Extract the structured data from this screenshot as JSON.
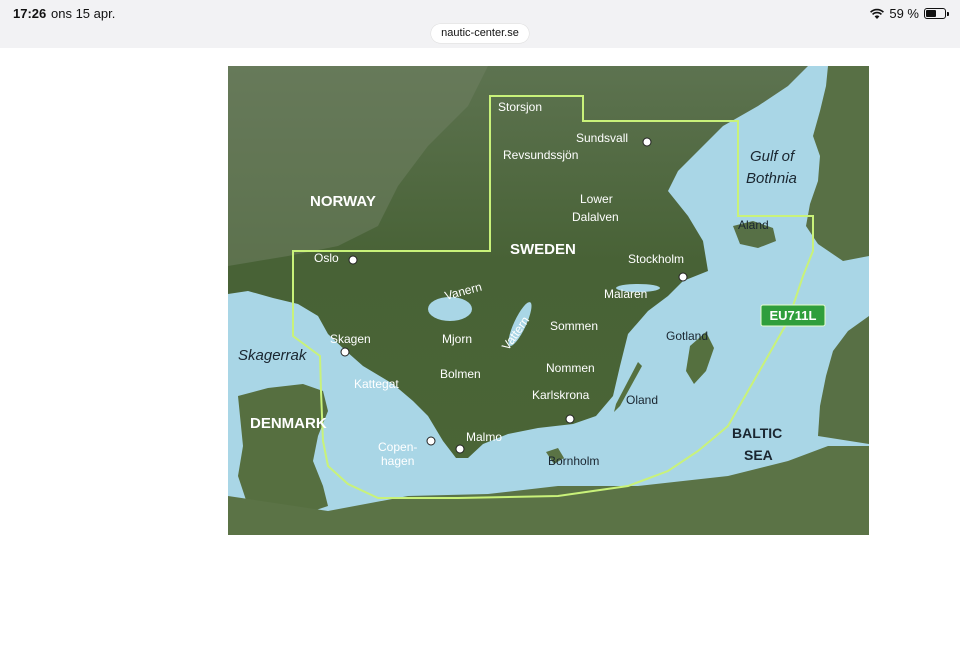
{
  "status_bar": {
    "time": "17:26",
    "date": "ons 15 apr.",
    "battery_text": "59 %",
    "battery_level": 0.59,
    "wifi_icon": "wifi-icon",
    "battery_icon": "battery-icon"
  },
  "browser": {
    "url": "nautic-center.se"
  },
  "map": {
    "coverage_badge": "EU711L",
    "colors": {
      "water": "#a9d6e6",
      "land": "#4f6b3e",
      "coverage_outline": "#c9f27a",
      "badge": "#2f9e3c"
    },
    "labels": {
      "norway": "NORWAY",
      "sweden": "SWEDEN",
      "denmark": "DENMARK",
      "gulf_line1": "Gulf of",
      "gulf_line2": "Bothnia",
      "skagerrak": "Skagerrak",
      "kattegat": "Kattegat",
      "baltic_line1": "BALTIC",
      "baltic_line2": "SEA",
      "storsjon": "Storsjon",
      "sundsvall": "Sundsvall",
      "revsundssjon": "Revsundssjön",
      "lower_line1": "Lower",
      "lower_line2": "Dalalven",
      "aland": "Aland",
      "oslo": "Oslo",
      "stockholm": "Stockholm",
      "vanern": "Vanern",
      "malaren": "Malaren",
      "skagen": "Skagen",
      "mjorn": "Mjorn",
      "vattern": "Vattern",
      "sommen": "Sommen",
      "gotland": "Gotland",
      "bolmen": "Bolmen",
      "nommen": "Nommen",
      "karlskrona": "Karlskrona",
      "oland": "Oland",
      "cph_line1": "Copen-",
      "cph_line2": "hagen",
      "malmo": "Malmo",
      "bornholm": "Bornholm"
    }
  }
}
